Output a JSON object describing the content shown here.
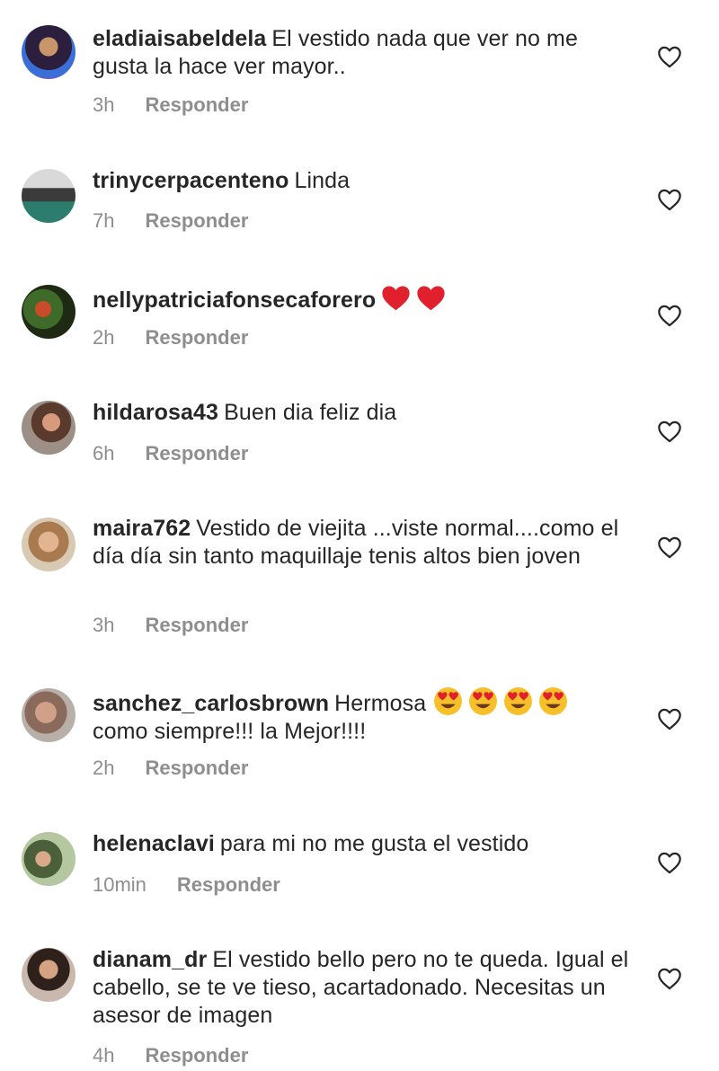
{
  "reply_label": "Responder",
  "comments": [
    {
      "user": "eladiaisabeldela",
      "text": "El vestido nada que ver no me gusta la hace ver mayor..",
      "time": "3h"
    },
    {
      "user": "trinycerpacenteno",
      "text": "Linda",
      "time": "7h"
    },
    {
      "user": "nellypatriciafonsecaforero",
      "text": "",
      "emojis": [
        "red-heart",
        "red-heart"
      ],
      "time": "2h"
    },
    {
      "user": "hildarosa43",
      "text": "Buen dia feliz dia",
      "time": "6h"
    },
    {
      "user": "maira762",
      "text": "Vestido de viejita ...viste normal....como el día día sin tanto maquillaje tenis altos bien joven",
      "time": "3h"
    },
    {
      "user": "sanchez_carlosbrown",
      "text_before": "Hermosa",
      "emojis": [
        "heart-eyes",
        "heart-eyes",
        "heart-eyes",
        "heart-eyes"
      ],
      "text_after": "como siempre!!! la Mejor!!!!",
      "time": "2h"
    },
    {
      "user": "helenaclavi",
      "text": "para mi  no me gusta el vestido",
      "time": "10min"
    },
    {
      "user": "dianam_dr",
      "text": "El vestido bello pero no te queda. Igual el cabello, se te ve tieso, acartadonado. Necesitas un asesor de imagen",
      "time": "4h"
    }
  ],
  "colors": {
    "text": "#262626",
    "meta": "#8e8e8e",
    "background": "#ffffff"
  }
}
